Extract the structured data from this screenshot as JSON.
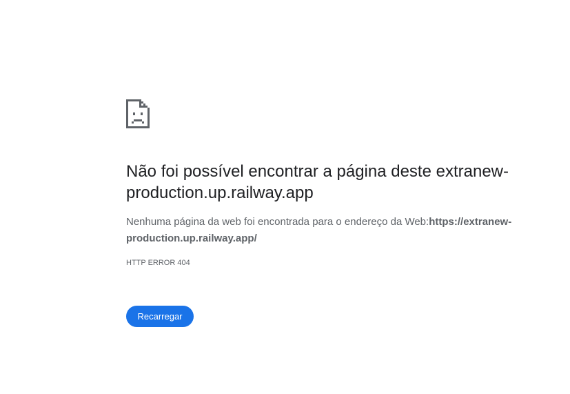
{
  "error_page": {
    "icon": "sad-page-icon",
    "title_part1": "Não foi possível encontrar a página deste",
    "title_host": "extranew-production.up.railway.app",
    "description_prefix": "Nenhuma página da web foi encontrada para o endereço da Web:",
    "description_url": "https://extranew-production.up.railway.app/",
    "error_code": "HTTP ERROR 404",
    "reload_label": "Recarregar"
  },
  "colors": {
    "button_bg": "#1a73e8",
    "text_primary": "#202124",
    "text_secondary": "#5f6368"
  }
}
